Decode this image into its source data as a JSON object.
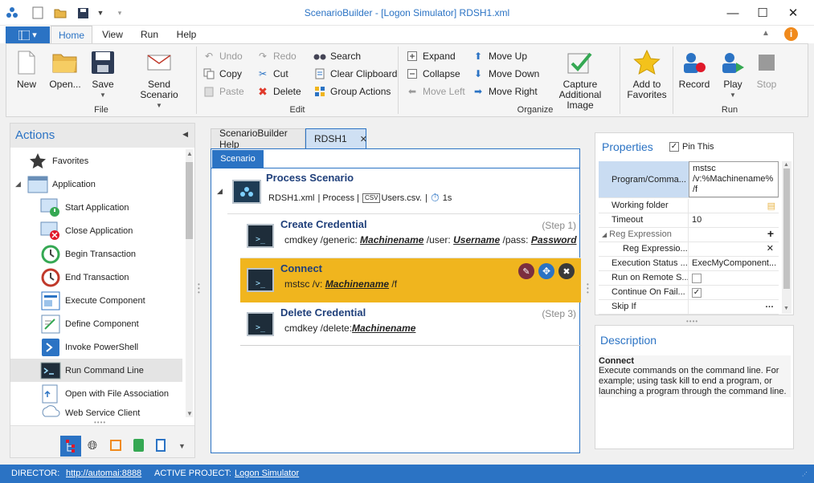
{
  "window": {
    "title": "ScenarioBuilder - [Logon Simulator] RDSH1.xml"
  },
  "ribbon_tabs": [
    "Home",
    "View",
    "Run",
    "Help"
  ],
  "ribbon": {
    "file": {
      "group": "File",
      "new": "New",
      "open": "Open...",
      "save": "Save",
      "send": "Send Scenario"
    },
    "edit": {
      "group": "Edit",
      "undo": "Undo",
      "redo": "Redo",
      "search": "Search",
      "copy": "Copy",
      "cut": "Cut",
      "clear_clipboard": "Clear Clipboard",
      "paste": "Paste",
      "delete": "Delete",
      "group_actions": "Group Actions"
    },
    "organize": {
      "group": "Organize",
      "expand": "Expand",
      "collapse": "Collapse",
      "move_left": "Move Left",
      "move_up": "Move Up",
      "move_down": "Move Down",
      "move_right": "Move Right",
      "capture_line1": "Capture",
      "capture_line2": "Additional Image",
      "favorites_line1": "Add to",
      "favorites_line2": "Favorites"
    },
    "run": {
      "group": "Run",
      "record": "Record",
      "play": "Play",
      "stop": "Stop"
    }
  },
  "actions_panel": {
    "title": "Actions",
    "items": [
      {
        "label": "Favorites",
        "icon": "star-icon"
      },
      {
        "label": "Application",
        "icon": "application-icon"
      },
      {
        "label": "Start Application",
        "icon": "start-application-icon"
      },
      {
        "label": "Close Application",
        "icon": "close-application-icon"
      },
      {
        "label": "Begin Transaction",
        "icon": "begin-transaction-icon"
      },
      {
        "label": "End Transaction",
        "icon": "end-transaction-icon"
      },
      {
        "label": "Execute Component",
        "icon": "execute-component-icon"
      },
      {
        "label": "Define Component",
        "icon": "define-component-icon"
      },
      {
        "label": "Invoke PowerShell",
        "icon": "powershell-icon"
      },
      {
        "label": "Run Command Line",
        "icon": "command-line-icon"
      },
      {
        "label": "Open with File Association",
        "icon": "file-association-icon"
      },
      {
        "label": "Web Service Client",
        "icon": "web-service-icon"
      }
    ]
  },
  "document_tabs": [
    "ScenarioBuilder Help",
    "RDSH1"
  ],
  "scenario": {
    "subtab": "Scenario",
    "title": "Process Scenario",
    "file": "RDSH1.xml",
    "type": "| Process |",
    "csv_badge": "CSV",
    "csv": "Users.csv.",
    "sep": "|",
    "time": "1s",
    "steps": [
      {
        "name": "Create Credential",
        "number": "(Step 1)",
        "cmd_prefix": "cmdkey /generic:",
        "var1": "Machinename",
        "mid1": "/user:",
        "var2": "Username",
        "mid2": "/pass:",
        "var3": "Password"
      },
      {
        "name": "Connect",
        "cmd_prefix": "mstsc /v:",
        "var1": "Machinename",
        "suffix": "/f"
      },
      {
        "name": "Delete Credential",
        "number": "(Step 3)",
        "cmd_prefix": "cmdkey /delete:",
        "var1": "Machinename"
      }
    ]
  },
  "properties": {
    "title": "Properties",
    "pin_label": "Pin This",
    "program_name": "Program/Comma...",
    "program_value": [
      "mstsc",
      "/v:%Machinename%",
      "/f"
    ],
    "rows": [
      {
        "name": "Working folder",
        "value": ""
      },
      {
        "name": "Timeout",
        "value": "10"
      },
      {
        "name": "Reg Expression",
        "value": ""
      },
      {
        "name": "Reg Expressio...",
        "value": ""
      },
      {
        "name": "Execution Status ...",
        "value": "ExecMyComponent..."
      },
      {
        "name": "Run on Remote S...",
        "value": ""
      },
      {
        "name": "Continue On Fail...",
        "value": ""
      },
      {
        "name": "Skip If",
        "value": ""
      }
    ]
  },
  "description": {
    "title": "Description",
    "heading": "Connect",
    "text": "Execute commands on the command line. For example; using task kill to end a program, or launching a program through the command line."
  },
  "status_bar": {
    "director_label": "DIRECTOR:",
    "director_url": "http://automai:8888",
    "project_label": "ACTIVE PROJECT:",
    "project": "Logon Simulator"
  },
  "colors": {
    "accent": "#2b73c4",
    "selected_step": "#f0b51e",
    "title_text": "#1f3f7a"
  }
}
